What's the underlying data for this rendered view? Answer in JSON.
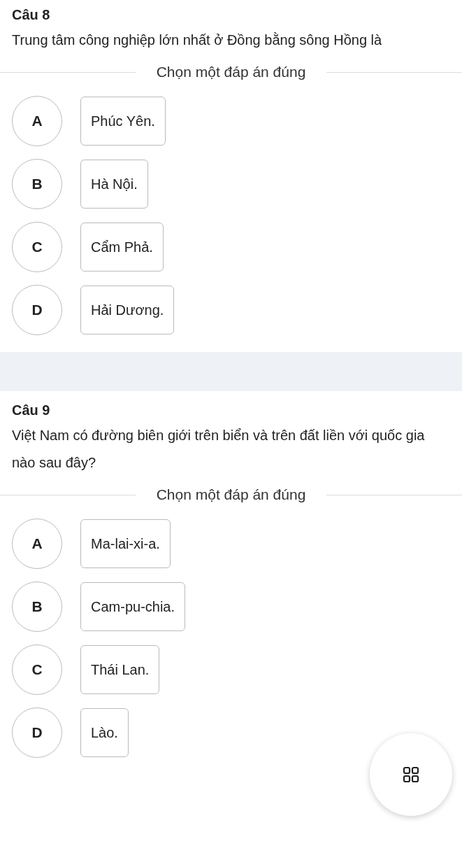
{
  "questions": [
    {
      "title": "Câu 8",
      "text": "Trung tâm công nghiệp lớn nhất ở Đồng bằng sông Hồng là",
      "prompt": "Chọn một đáp án đúng",
      "options": [
        {
          "letter": "A",
          "text": "Phúc Yên."
        },
        {
          "letter": "B",
          "text": "Hà Nội."
        },
        {
          "letter": "C",
          "text": "Cẩm Phả."
        },
        {
          "letter": "D",
          "text": "Hải Dương."
        }
      ]
    },
    {
      "title": "Câu 9",
      "text": "Việt Nam có đường biên giới trên biển và trên đất liền với quốc gia nào sau đây?",
      "prompt": "Chọn một đáp án đúng",
      "options": [
        {
          "letter": "A",
          "text": "Ma-lai-xi-a."
        },
        {
          "letter": "B",
          "text": "Cam-pu-chia."
        },
        {
          "letter": "C",
          "text": "Thái Lan."
        },
        {
          "letter": "D",
          "text": "Lào."
        }
      ]
    }
  ]
}
